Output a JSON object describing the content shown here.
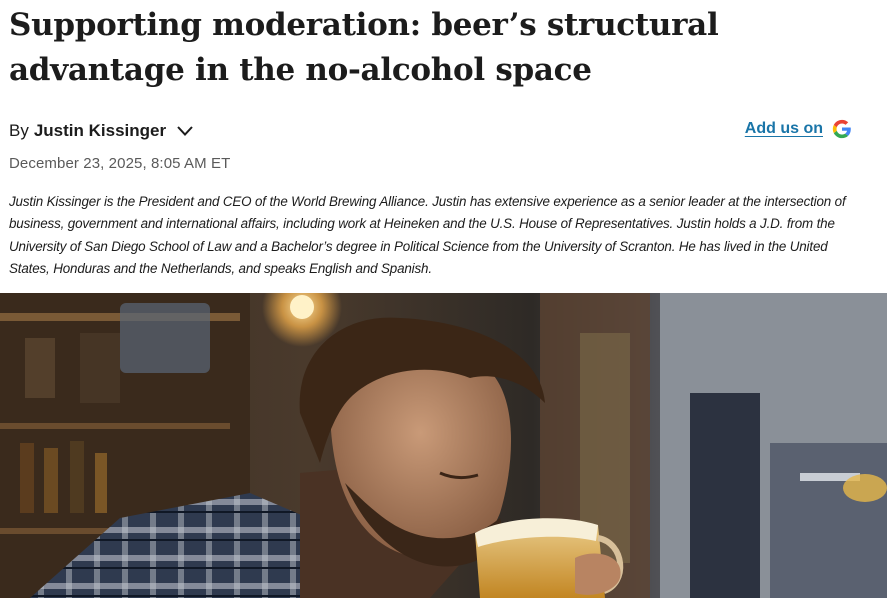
{
  "article": {
    "headline": "Supporting moderation: beer’s structural advantage in the no-alcohol space",
    "byline_prefix": "By",
    "author": "Justin Kissinger",
    "dateline": "December 23, 2025, 8:05 AM ET",
    "bio": "Justin Kissinger is the President and CEO of the World Brewing Alliance. Justin has extensive experience as a senior leader at the intersection of business, government and international affairs, including work at Heineken and the U.S. House of Representatives. Justin holds a J.D. from the University of San Diego School of Law and a Bachelor’s degree in Political Science from the University of Scranton. He has lived in the United States, Honduras and the Netherlands, and speaks English and Spanish."
  },
  "actions": {
    "add_us_label": "Add us on",
    "add_us_icon": "google-icon",
    "author_toggle_icon": "chevron-down-icon"
  },
  "colors": {
    "link": "#1a75a8",
    "text": "#1c1c1c",
    "muted": "#5a5a5a",
    "google_blue": "#4285F4",
    "google_red": "#EA4335",
    "google_yellow": "#FBBC05",
    "google_green": "#34A853"
  }
}
